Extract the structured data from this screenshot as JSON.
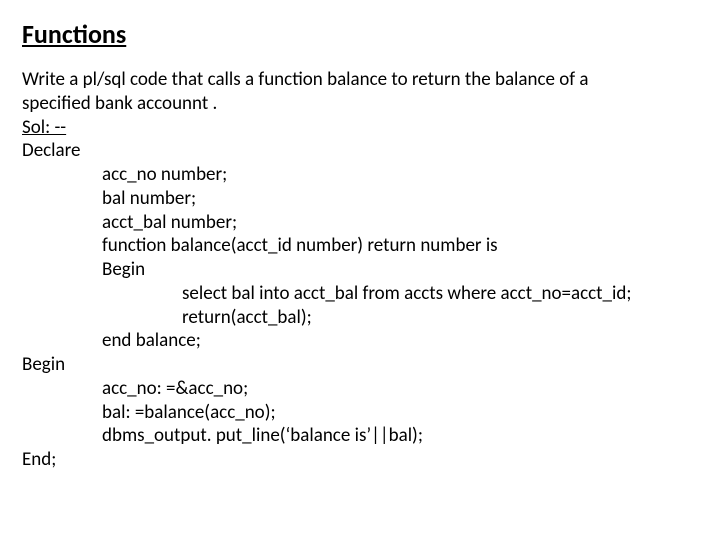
{
  "title": "Functions",
  "prompt_line1": "Write a pl/sql code that calls a function balance to return the balance of a",
  "prompt_line2": "specified bank accounnt .",
  "sol_label": "Sol: --",
  "code": {
    "declare": "Declare",
    "d1": "acc_no number;",
    "d2": "bal number;",
    "d3": "acct_bal number;",
    "d4": "function balance(acct_id number) return number is",
    "d5": "Begin",
    "d6": "select bal into acct_bal from accts where acct_no=acct_id;",
    "d7": "return(acct_bal);",
    "d8": "end balance;",
    "begin": "Begin",
    "b1": "acc_no: =&acc_no;",
    "b2": "bal: =balance(acc_no);",
    "b3": "dbms_output. put_line(‘balance is’||bal);",
    "end": "End;"
  }
}
